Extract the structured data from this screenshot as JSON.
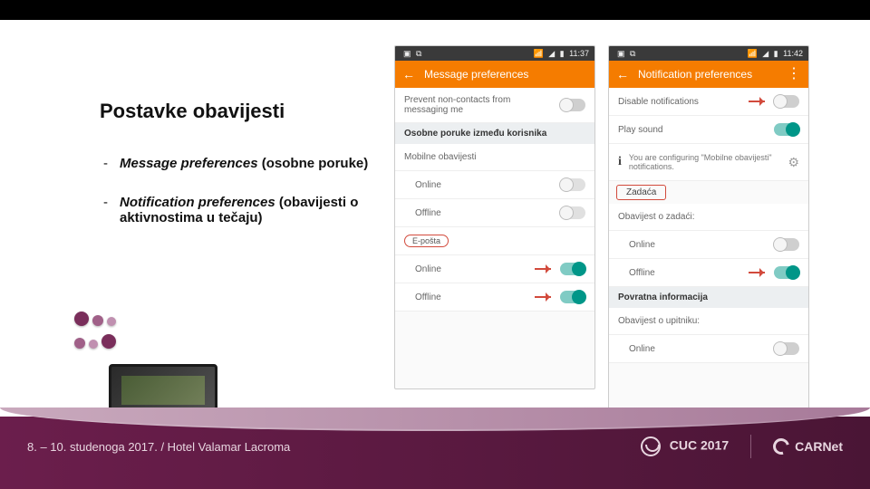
{
  "slide": {
    "title": "Postavke obavijesti",
    "bullets": [
      {
        "em": "Message preferences",
        "sub": "(osobne poruke)"
      },
      {
        "em": "Notification preferences",
        "sub": "(obavijesti o aktivnostima u tečaju)"
      }
    ]
  },
  "footer": {
    "date_venue": "8. – 10. studenoga 2017. / Hotel Valamar Lacroma",
    "conf": "CUC 2017",
    "org": "CARNet"
  },
  "phone1": {
    "time": "11:37",
    "title": "Message preferences",
    "rows": {
      "prevent": "Prevent non-contacts from messaging me",
      "section_personal": "Osobne poruke između korisnika",
      "mobile_hdr": "Mobilne obavijesti",
      "online": "Online",
      "offline": "Offline",
      "email_chip": "E-pošta"
    }
  },
  "phone2": {
    "time": "11:42",
    "title": "Notification preferences",
    "rows": {
      "disable": "Disable notifications",
      "sound": "Play sound",
      "info": "You are configuring \"Mobilne obavijesti\" notifications.",
      "zadaca": "Zadaća",
      "obav_zadaci": "Obavijest o zadaći:",
      "online": "Online",
      "offline": "Offline",
      "povratna": "Povratna informacija",
      "obav_upitniku": "Obavijest o upitniku:"
    }
  }
}
